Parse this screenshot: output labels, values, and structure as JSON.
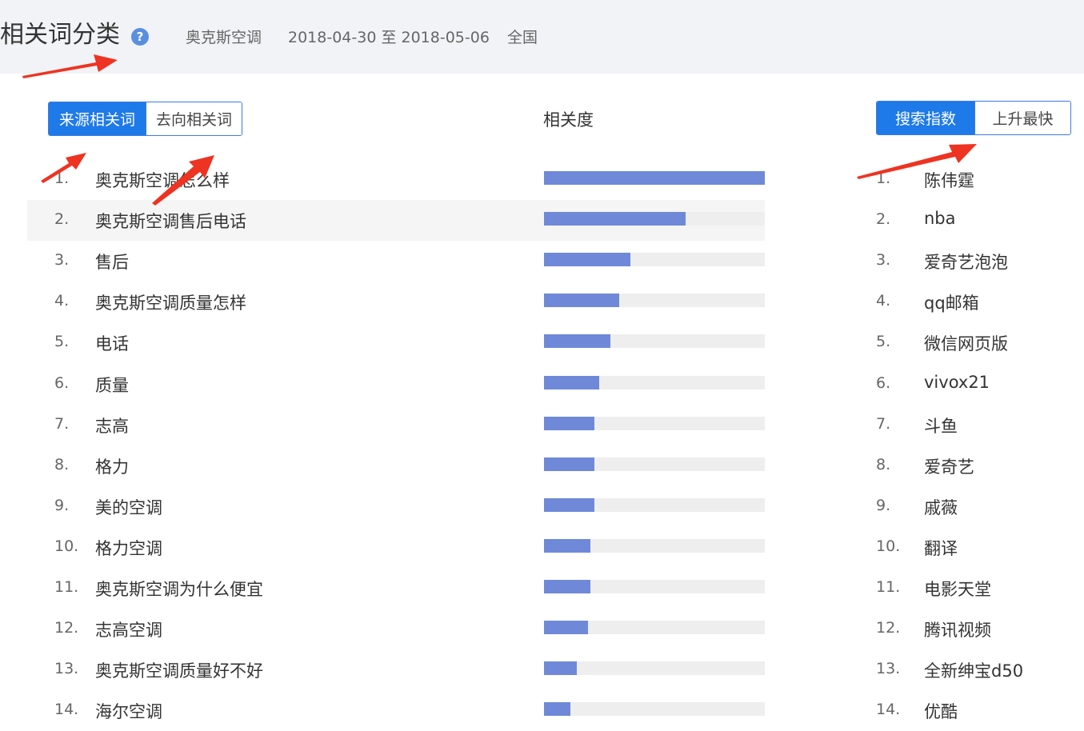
{
  "header": {
    "title": "相关词分类",
    "help_icon": "question-circle-icon",
    "keyword": "奥克斯空调",
    "date_range": "2018-04-30 至 2018-05-06",
    "region": "全国"
  },
  "left_toggle": {
    "active": "来源相关词",
    "inactive": "去向相关词"
  },
  "right_toggle": {
    "active": "搜索指数",
    "inactive": "上升最快"
  },
  "relevance_header": "相关度",
  "colors": {
    "accent": "#1e7ae8",
    "bar": "#6f89d8",
    "track": "#eeeeee",
    "arrow": "#ee3322"
  },
  "left_list": [
    {
      "rank": "1.",
      "keyword": "奥克斯空调怎么样",
      "relevance": 1.0
    },
    {
      "rank": "2.",
      "keyword": "奥克斯空调售后电话",
      "relevance": 0.64
    },
    {
      "rank": "3.",
      "keyword": "售后",
      "relevance": 0.39
    },
    {
      "rank": "4.",
      "keyword": "奥克斯空调质量怎样",
      "relevance": 0.34
    },
    {
      "rank": "5.",
      "keyword": "电话",
      "relevance": 0.3
    },
    {
      "rank": "6.",
      "keyword": "质量",
      "relevance": 0.25
    },
    {
      "rank": "7.",
      "keyword": "志高",
      "relevance": 0.23
    },
    {
      "rank": "8.",
      "keyword": "格力",
      "relevance": 0.23
    },
    {
      "rank": "9.",
      "keyword": "美的空调",
      "relevance": 0.23
    },
    {
      "rank": "10.",
      "keyword": "格力空调",
      "relevance": 0.21
    },
    {
      "rank": "11.",
      "keyword": "奥克斯空调为什么便宜",
      "relevance": 0.21
    },
    {
      "rank": "12.",
      "keyword": "志高空调",
      "relevance": 0.2
    },
    {
      "rank": "13.",
      "keyword": "奥克斯空调质量好不好",
      "relevance": 0.15
    },
    {
      "rank": "14.",
      "keyword": "海尔空调",
      "relevance": 0.12
    }
  ],
  "right_list": [
    {
      "rank": "1.",
      "keyword": "陈伟霆"
    },
    {
      "rank": "2.",
      "keyword": "nba"
    },
    {
      "rank": "3.",
      "keyword": "爱奇艺泡泡"
    },
    {
      "rank": "4.",
      "keyword": "qq邮箱"
    },
    {
      "rank": "5.",
      "keyword": "微信网页版"
    },
    {
      "rank": "6.",
      "keyword": "vivox21"
    },
    {
      "rank": "7.",
      "keyword": "斗鱼"
    },
    {
      "rank": "8.",
      "keyword": "爱奇艺"
    },
    {
      "rank": "9.",
      "keyword": "戚薇"
    },
    {
      "rank": "10.",
      "keyword": "翻译"
    },
    {
      "rank": "11.",
      "keyword": "电影天堂"
    },
    {
      "rank": "12.",
      "keyword": "腾讯视频"
    },
    {
      "rank": "13.",
      "keyword": "全新绅宝d50"
    },
    {
      "rank": "14.",
      "keyword": "优酷"
    }
  ]
}
